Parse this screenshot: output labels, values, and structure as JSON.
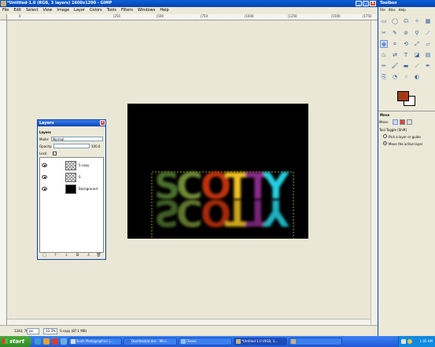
{
  "main_window": {
    "title": "*Untitled-1.0 (RGB, 3 layers) 1600x1200 - GIMP",
    "min": "_",
    "max": "□",
    "close": "x",
    "menu": [
      "File",
      "Edit",
      "Select",
      "View",
      "Image",
      "Layer",
      "Colors",
      "Tools",
      "Filters",
      "Windows",
      "Help"
    ],
    "ruler_labels": [
      "0",
      "|250",
      "|500",
      "|750",
      "|1000",
      "|1250",
      "|1500",
      "|1750",
      "|2000"
    ],
    "status": {
      "coords": "1344, 765",
      "unit": "px",
      "zoom": "33.3%",
      "message": "S copy (87.1 MB)"
    }
  },
  "canvas": {
    "text": "SCOTTY",
    "reflection": "SCOTTY",
    "colors": [
      "#4a6e2a",
      "#7a9a3a",
      "#c0300a",
      "#f0c020",
      "#8a2a8a",
      "#20d0e0"
    ]
  },
  "layers_dialog": {
    "title": "Layers",
    "tab_label": "Layers",
    "mode_label": "Mode:",
    "mode_value": "Normal",
    "opacity_label": "Opacity:",
    "opacity_value": "100.0",
    "lock_label": "Lock:",
    "layers": [
      {
        "name": "S copy",
        "thumb": "check"
      },
      {
        "name": "S",
        "thumb": "check"
      },
      {
        "name": "Background",
        "thumb": "black"
      }
    ],
    "buttons": [
      "□",
      "↑",
      "↓",
      "⧉",
      "⚓",
      "🗑"
    ]
  },
  "toolbox": {
    "title": "Toolbox",
    "menu": [
      "File",
      "Xtns",
      "Help"
    ],
    "fg_color": "#a33a17",
    "bg_color": "#ffffff"
  },
  "tool_options": {
    "title": "Move",
    "move_label": "Move:",
    "toggle_label": "Tool Toggle  (Shift)",
    "option_pick": "Pick a layer or guide",
    "option_move": "Move the active layer"
  },
  "taskbar": {
    "start": "start",
    "tasks": [
      {
        "label": "Scott Photographics |...",
        "active": false
      },
      {
        "label": "Overtleshot.doc - Micr...",
        "active": false
      },
      {
        "label": "iTunes",
        "active": false
      },
      {
        "label": "*Untitled-1.0 (RGB, 3...",
        "active": true
      },
      {
        "label": "",
        "active": false
      }
    ],
    "clock": "1:05 AM"
  }
}
